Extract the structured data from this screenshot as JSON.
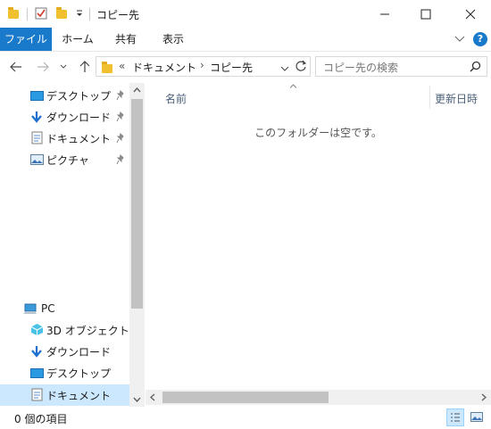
{
  "window": {
    "title": "コピー先",
    "minimize_glyph": "—",
    "maximize_glyph": "☐",
    "close_glyph": "✕"
  },
  "ribbon": {
    "tabs": [
      {
        "label": "ファイル"
      },
      {
        "label": "ホーム"
      },
      {
        "label": "共有"
      },
      {
        "label": "表示"
      }
    ],
    "help_glyph": "?"
  },
  "address": {
    "overflow": "«",
    "crumbs": [
      "ドキュメント",
      "コピー先"
    ],
    "separator": "›"
  },
  "search": {
    "placeholder": "コピー先の検索"
  },
  "nav_pane": {
    "quick_access": [
      {
        "label": "デスクトップ",
        "icon": "desktop-icon"
      },
      {
        "label": "ダウンロード",
        "icon": "download-icon"
      },
      {
        "label": "ドキュメント",
        "icon": "document-icon"
      },
      {
        "label": "ピクチャ",
        "icon": "pictures-icon"
      }
    ],
    "pc": {
      "label": "PC"
    },
    "pc_items": [
      {
        "label": "3D オブジェクト",
        "icon": "3d-objects-icon"
      },
      {
        "label": "ダウンロード",
        "icon": "download-icon"
      },
      {
        "label": "デスクトップ",
        "icon": "desktop-icon"
      },
      {
        "label": "ドキュメント",
        "icon": "document-icon",
        "selected": true
      }
    ]
  },
  "content": {
    "columns": [
      {
        "label": "名前"
      },
      {
        "label": "更新日時"
      }
    ],
    "empty_message": "このフォルダーは空です。"
  },
  "status_bar": {
    "item_count": "0 個の項目"
  },
  "colors": {
    "accent": "#1979ca",
    "selection": "#cce8ff",
    "folder": "#f0c02e"
  }
}
